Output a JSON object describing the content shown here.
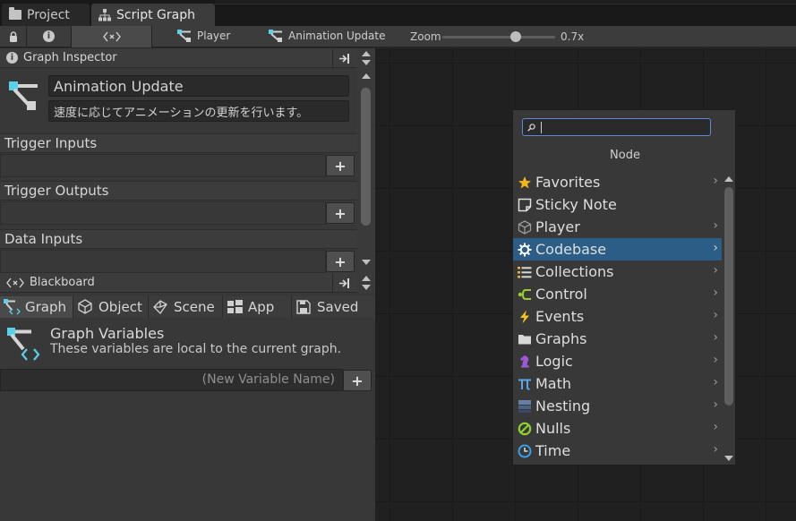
{
  "tabs": [
    {
      "label": "Project",
      "icon": "folder-icon"
    },
    {
      "label": "Script Graph",
      "icon": "hierarchy-icon"
    }
  ],
  "toolbar": {
    "breadcrumb_1": "Player",
    "breadcrumb_2": "Animation Update",
    "zoom_label": "Zoom",
    "zoom_value": "0.7x",
    "zoom_level": 0.7
  },
  "inspector": {
    "title": "Graph Inspector",
    "graph_name": "Animation Update",
    "graph_description": "速度に応じてアニメーションの更新を行います。",
    "sections": [
      {
        "label": "Trigger Inputs"
      },
      {
        "label": "Trigger Outputs"
      },
      {
        "label": "Data Inputs"
      }
    ],
    "add_label": "+"
  },
  "blackboard": {
    "title": "Blackboard",
    "tabs": [
      {
        "label": "Graph",
        "icon": "graph-icon"
      },
      {
        "label": "Object",
        "icon": "cube-icon"
      },
      {
        "label": "Scene",
        "icon": "scene-icon"
      },
      {
        "label": "App",
        "icon": "app-icon"
      },
      {
        "label": "Saved",
        "icon": "save-icon"
      }
    ],
    "heading": "Graph Variables",
    "subheading": "These variables are local to the current graph.",
    "new_var_placeholder": "(New Variable Name)",
    "add_label": "+"
  },
  "node_menu": {
    "search_value": "",
    "title": "Node",
    "items": [
      {
        "label": "Favorites",
        "icon": "star-icon",
        "color": "#f2b51d"
      },
      {
        "label": "Sticky Note",
        "icon": "sticky-note-icon",
        "color": "#e0e0e0"
      },
      {
        "label": "Player",
        "icon": "cube-outline-icon",
        "color": "#9a9a9a"
      },
      {
        "label": "Codebase",
        "icon": "gear-icon",
        "color": "#ffffff"
      },
      {
        "label": "Collections",
        "icon": "list-icon",
        "color": "#e8b43a"
      },
      {
        "label": "Control",
        "icon": "branch-icon",
        "color": "#9acd32"
      },
      {
        "label": "Events",
        "icon": "bolt-icon",
        "color": "#f5c518"
      },
      {
        "label": "Graphs",
        "icon": "folder-icon",
        "color": "#d8d8d8"
      },
      {
        "label": "Logic",
        "icon": "chess-knight-icon",
        "color": "#9b59d6"
      },
      {
        "label": "Math",
        "icon": "pi-icon",
        "color": "#5aa8e8"
      },
      {
        "label": "Nesting",
        "icon": "nesting-icon",
        "color": "#6a7fa8"
      },
      {
        "label": "Nulls",
        "icon": "null-icon",
        "color": "#8fd12f"
      },
      {
        "label": "Time",
        "icon": "clock-icon",
        "color": "#3c9ee8"
      }
    ],
    "selected_index": 3
  }
}
